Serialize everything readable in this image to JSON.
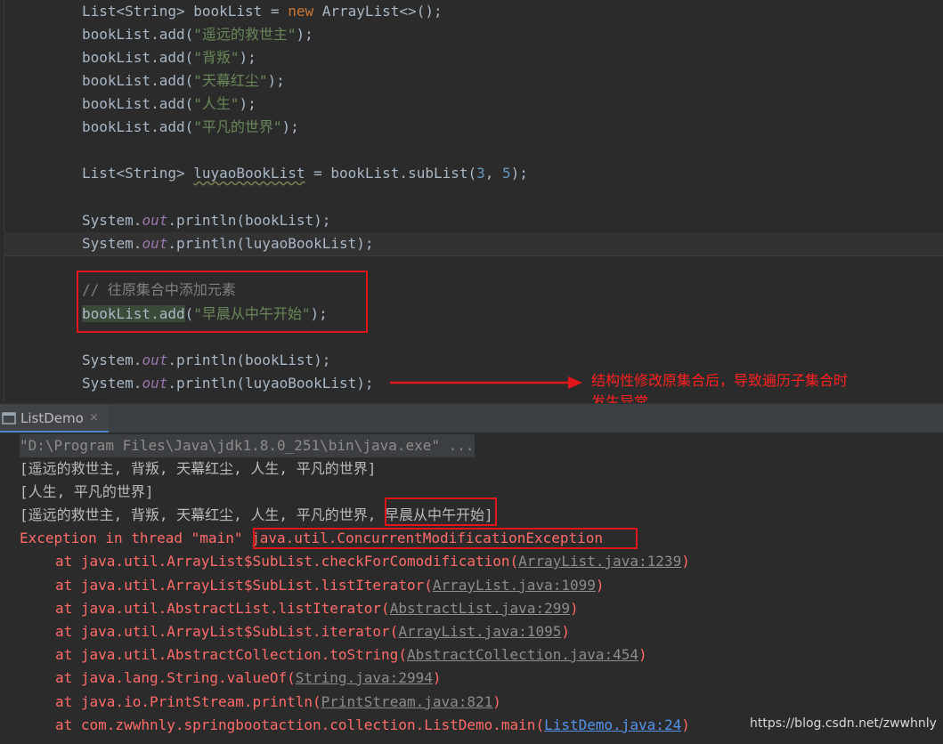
{
  "editor": {
    "lines": {
      "l1": {
        "a": "List<String> bookList = ",
        "kw": "new",
        "b": " ArrayList<>();"
      },
      "l2": {
        "a": "bookList.add(",
        "s": "\"遥远的救世主\"",
        "b": ");"
      },
      "l3": {
        "a": "bookList.add(",
        "s": "\"背叛\"",
        "b": ");"
      },
      "l4": {
        "a": "bookList.add(",
        "s": "\"天幕红尘\"",
        "b": ");"
      },
      "l5": {
        "a": "bookList.add(",
        "s": "\"人生\"",
        "b": ");"
      },
      "l6": {
        "a": "bookList.add(",
        "s": "\"平凡的世界\"",
        "b": ");"
      },
      "l7": {
        "a": "List<String> ",
        "var": "luyaoBookList",
        "b": " = bookList.subList(",
        "n1": "3",
        "c": ", ",
        "n2": "5",
        "d": ");"
      },
      "l8": {
        "a": "System.",
        "f": "out",
        "b": ".println(bookList);"
      },
      "l9": {
        "a": "System.",
        "f": "out",
        "b": ".println(luyaoBookList);"
      },
      "l10": {
        "cmt": "// 往原集合中添加元素"
      },
      "l11": {
        "sel": "bookList.add",
        "a": "(",
        "s": "\"早晨从中午开始\"",
        "b": ");"
      },
      "l12": {
        "a": "System.",
        "f": "out",
        "b": ".println(bookList);"
      },
      "l13": {
        "a": "System.",
        "f": "out",
        "b": ".println(luyaoBookList);"
      }
    },
    "annotation": [
      "结构性修改原集合后，导致遍历子集合时",
      "发生异常"
    ]
  },
  "tool_window": {
    "tab_label": "ListDemo",
    "tab_close": "×"
  },
  "console": {
    "cmd": "\"D:\\Program Files\\Java\\jdk1.8.0_251\\bin\\java.exe\" ...",
    "out1": "[遥远的救世主, 背叛, 天幕红尘, 人生, 平凡的世界]",
    "out2": "[人生, 平凡的世界]",
    "out3_a": "[遥远的救世主, 背叛, 天幕红尘, 人生, 平凡的世界, ",
    "out3_b": "早晨从中午开始]",
    "exc_a": "Exception in thread \"main\" ",
    "exc_b": "java.util.ConcurrentModificationException",
    "trace": [
      {
        "text": "at java.util.ArrayList$SubList.checkForComodification(",
        "link": "ArrayList.java:1239",
        "end": ")"
      },
      {
        "text": "at java.util.ArrayList$SubList.listIterator(",
        "link": "ArrayList.java:1099",
        "end": ")"
      },
      {
        "text": "at java.util.AbstractList.listIterator(",
        "link": "AbstractList.java:299",
        "end": ")"
      },
      {
        "text": "at java.util.ArrayList$SubList.iterator(",
        "link": "ArrayList.java:1095",
        "end": ")"
      },
      {
        "text": "at java.util.AbstractCollection.toString(",
        "link": "AbstractCollection.java:454",
        "end": ")"
      },
      {
        "text": "at java.lang.String.valueOf(",
        "link": "String.java:2994",
        "end": ")"
      },
      {
        "text": "at java.io.PrintStream.println(",
        "link": "PrintStream.java:821",
        "end": ")"
      },
      {
        "text": "at com.zwwhnly.springbootaction.collection.ListDemo.main(",
        "link": "ListDemo.java:24",
        "end": ")"
      }
    ]
  },
  "watermark": "https://blog.csdn.net/zwwhnly",
  "colors": {
    "accent_red": "#e0161b",
    "error_text": "#ff6b68",
    "link_blue": "#5394ec"
  }
}
